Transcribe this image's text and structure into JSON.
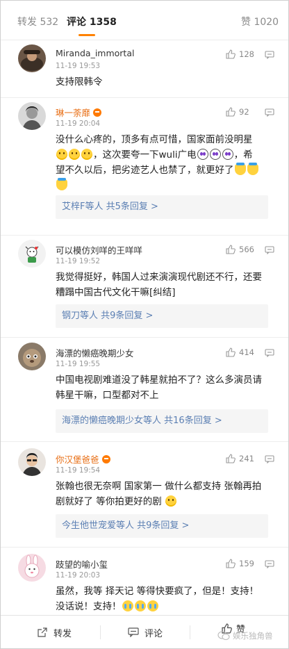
{
  "tabs": [
    {
      "label": "转发 532"
    },
    {
      "label": "评论 1358"
    },
    {
      "label": "赞 1020"
    }
  ],
  "comments": [
    {
      "name": "Miranda_immortal",
      "time": "11-19 19:53",
      "likes": "128",
      "text": "支持限韩令"
    },
    {
      "name": "琳一荼靡",
      "time": "11-19 20:04",
      "likes": "92",
      "text1": "没什么心疼的，顶多有点可惜，国家面前没明星",
      "text2": "，这次要夸一下wuli广电",
      "text3": "，希",
      "text4": "望不久以后，把劣迹艺人也禁了，就更好了",
      "reply": "艾梓F等人",
      "reply_count": "共5条回复 >"
    },
    {
      "name": "可以模仿刘咩的王咩咩",
      "time": "11-19 19:52",
      "likes": "566",
      "text1": "我觉得挺好，韩国人过来演演现代剧还不行，还要",
      "text2": "糟蹋中国古代文化干嘛[纠结]",
      "reply": "钢刀等人",
      "reply_count": "共9条回复 >"
    },
    {
      "name": "海漂的懒癌晚期少女",
      "time": "11-19 19:55",
      "likes": "414",
      "text1": "中国电视剧难道没了韩星就拍不了？这么多演员请",
      "text2": "韩星干嘛，口型都对不上",
      "reply": "海漂的懒癌晚期少女等人",
      "reply_count": "共16条回复 >"
    },
    {
      "name": "你汉堡爸爸",
      "time": "11-19 19:54",
      "likes": "241",
      "text1": "张翰也很无奈啊 国家第一 做什么都支持 张翰再拍",
      "text2": "剧就好了 等你拍更好的剧",
      "reply": "今生他世宠爱等人",
      "reply_count": "共9条回复 >"
    },
    {
      "name": "跂望的喻小玺",
      "time": "11-19 20:03",
      "likes": "159",
      "text1": "虽然，我等 择天记 等得快要疯了，但是！支持！",
      "text2": "没话说！支持！"
    }
  ],
  "bottom": {
    "repost": "转发",
    "comment": "评论",
    "like": "赞"
  },
  "watermark": "娱乐独角兽",
  "colors": {
    "accent": "#ff8200",
    "link": "#5b7fb3",
    "vip_name": "#e86f16"
  }
}
